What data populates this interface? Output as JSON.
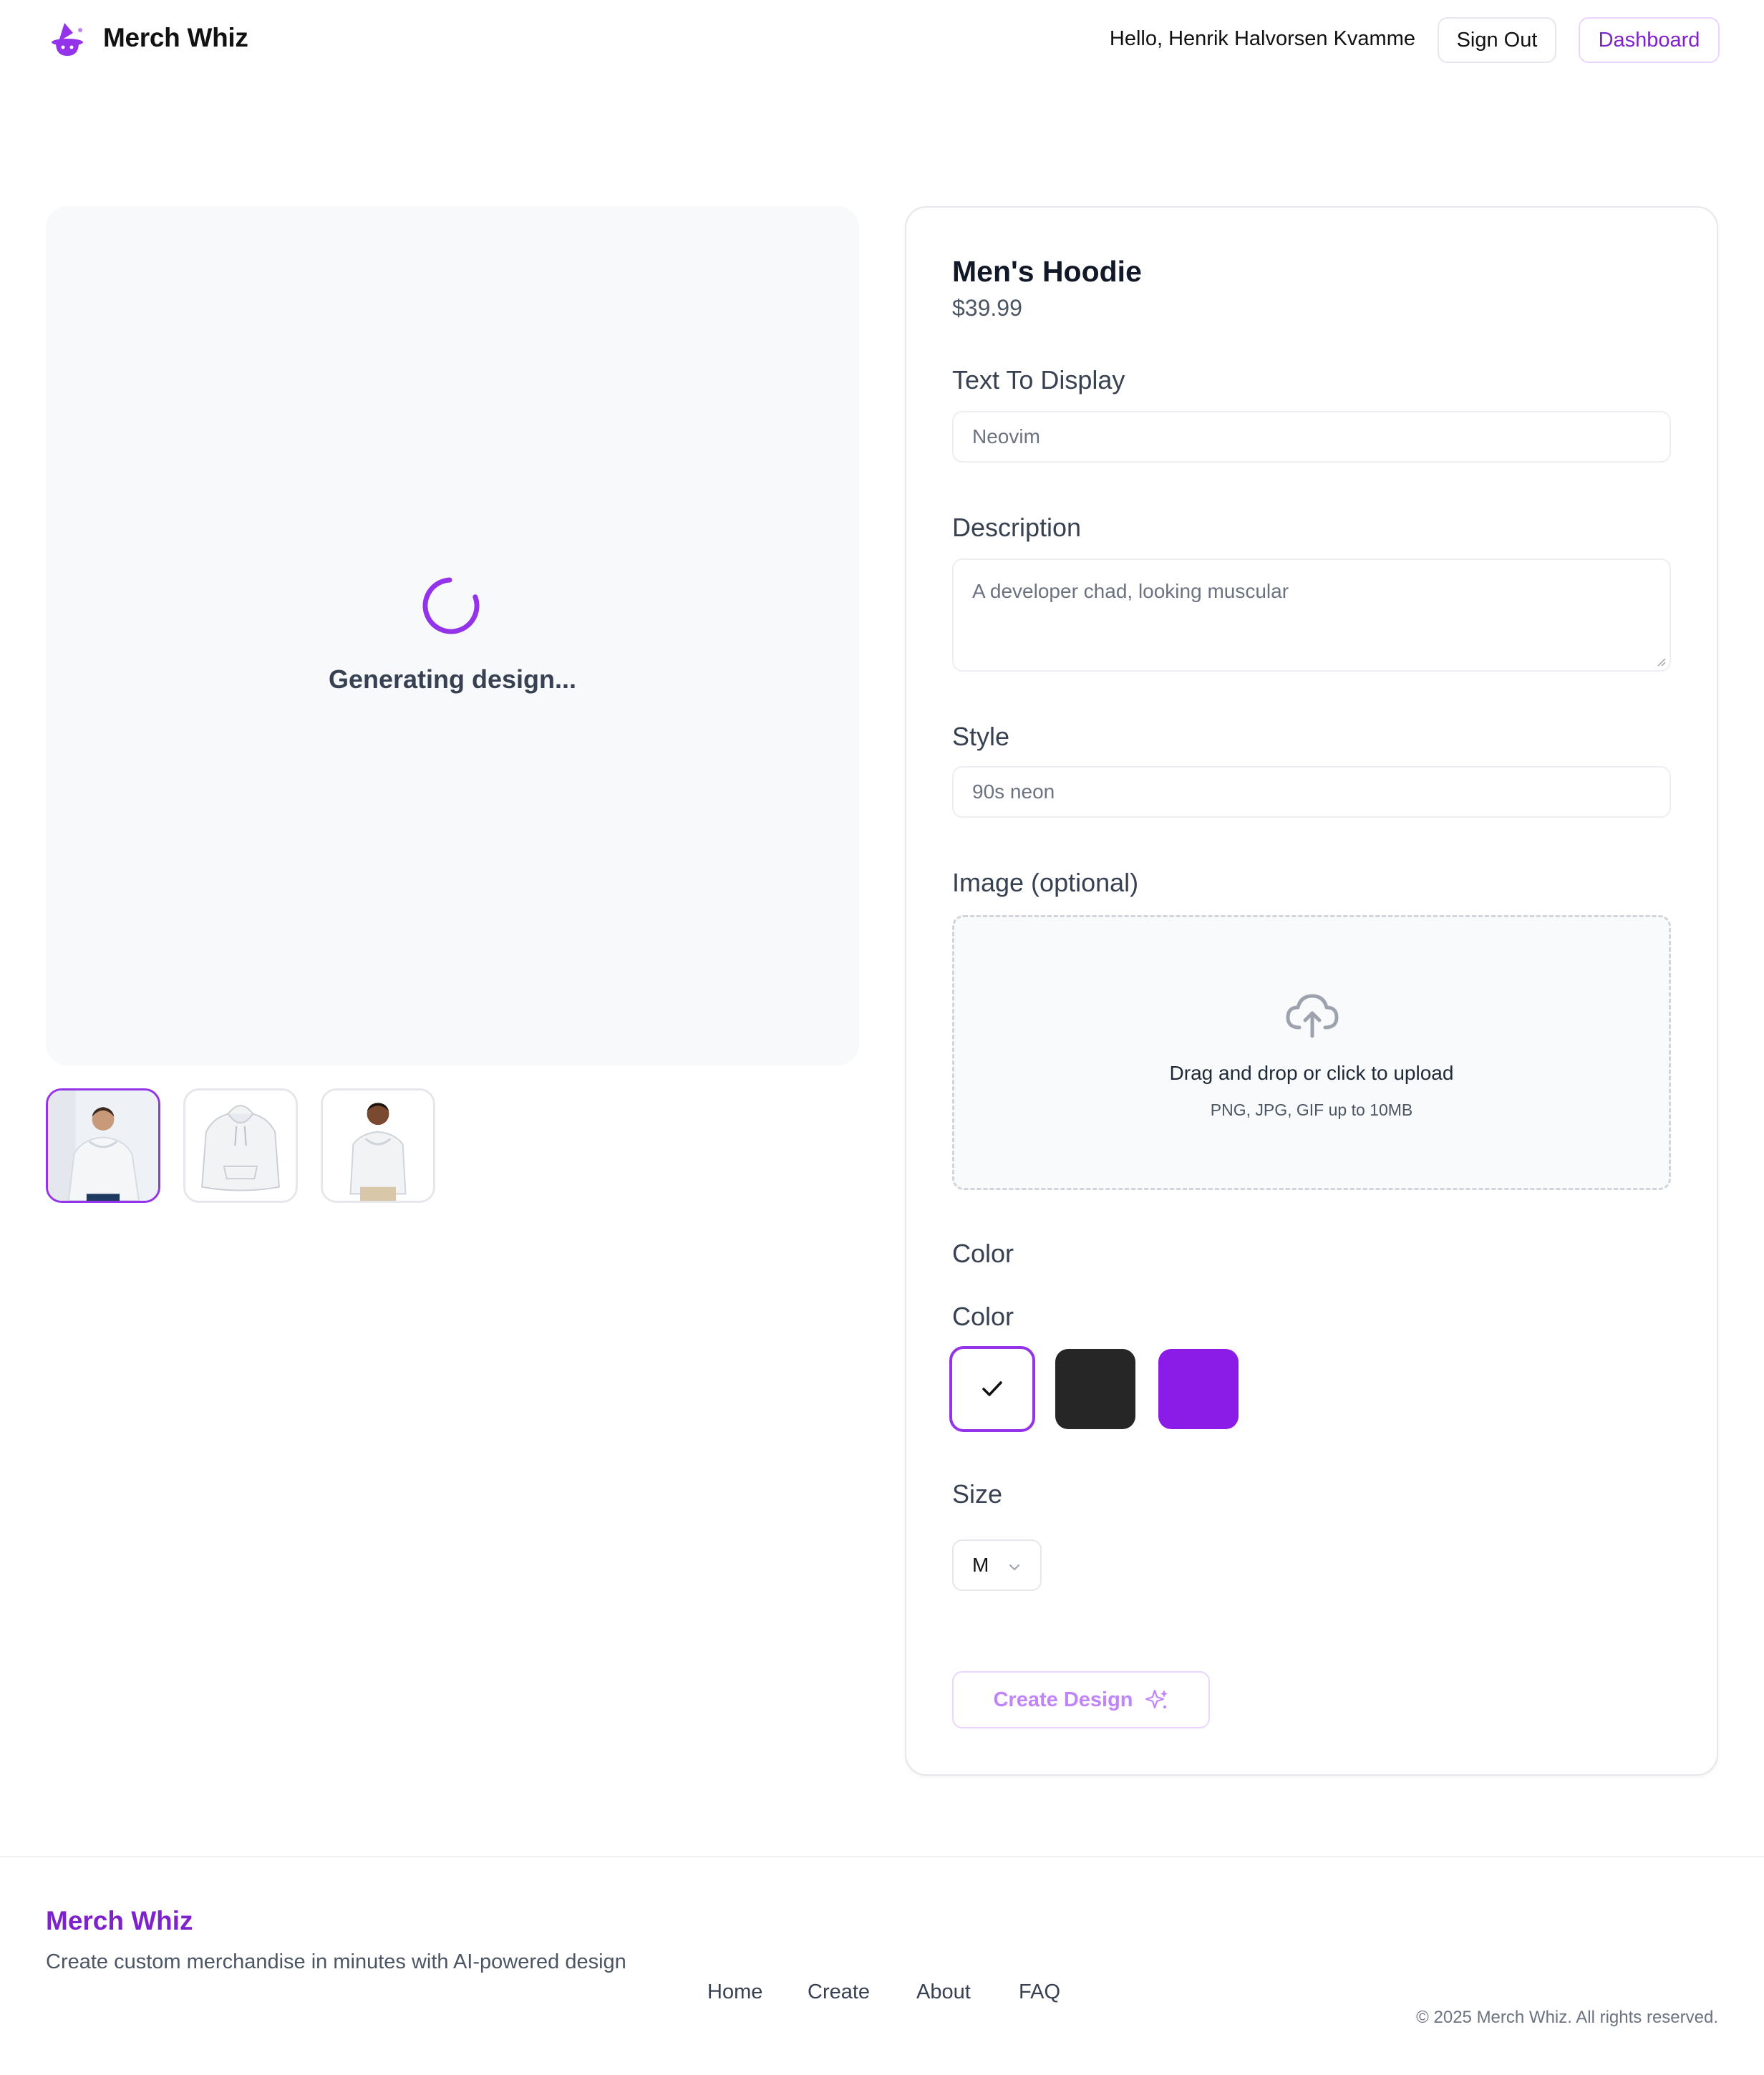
{
  "header": {
    "brand": "Merch Whiz",
    "greeting": "Hello, Henrik Halvorsen Kvamme",
    "sign_out": "Sign Out",
    "dashboard": "Dashboard"
  },
  "preview": {
    "status": "Generating design..."
  },
  "product": {
    "name": "Men's Hoodie",
    "price": "$39.99"
  },
  "form": {
    "text_label": "Text To Display",
    "text_placeholder": "Neovim",
    "description_label": "Description",
    "description_placeholder": "A developer chad, looking muscular",
    "style_label": "Style",
    "style_placeholder": "90s neon",
    "image_label": "Image (optional)",
    "upload_title": "Drag and drop or click to upload",
    "upload_sub": "PNG, JPG, GIF up to 10MB",
    "color_heading": "Color",
    "color_label": "Color",
    "colors": [
      {
        "name": "white",
        "hex": "#ffffff",
        "selected": true
      },
      {
        "name": "black",
        "hex": "#262626",
        "selected": false
      },
      {
        "name": "purple",
        "hex": "#8b1be6",
        "selected": false
      }
    ],
    "size_label": "Size",
    "size_value": "M",
    "create_button": "Create Design"
  },
  "footer": {
    "brand": "Merch Whiz",
    "tagline": "Create custom merchandise in minutes with AI-powered design",
    "nav": [
      "Home",
      "Create",
      "About",
      "FAQ"
    ],
    "copyright": "© 2025 Merch Whiz. All rights reserved."
  },
  "theme": {
    "accent": "#9333ea",
    "accent_text": "#7e22ce"
  }
}
